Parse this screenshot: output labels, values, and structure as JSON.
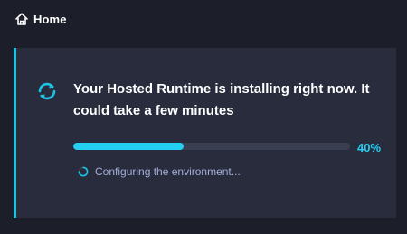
{
  "breadcrumb": {
    "icon": "home-icon",
    "label": "Home"
  },
  "install_card": {
    "icon": "refresh-spinner-icon",
    "title": "Your Hosted Runtime is installing right now. It could take a few minutes",
    "progress": {
      "value": 0.4,
      "label": "40%"
    },
    "status": {
      "icon": "loading-spinner-icon",
      "text": "Configuring the environment..."
    }
  },
  "colors": {
    "background": "#1c1f2a",
    "card": "#282c3d",
    "accent": "#1ec2e3",
    "progress_fill": "#23d0f3",
    "progress_track": "#3a3e51",
    "status_text": "#a3aed8"
  }
}
